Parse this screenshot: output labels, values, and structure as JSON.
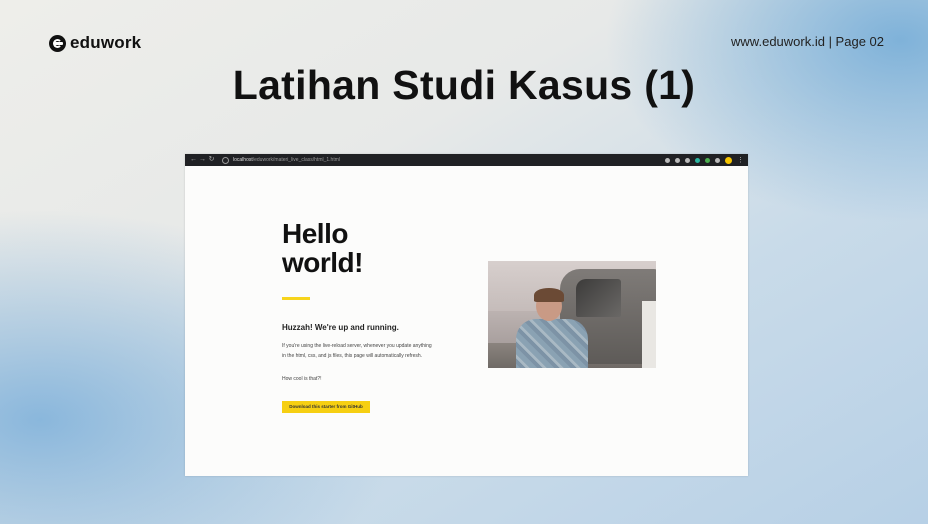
{
  "slide": {
    "logo_text": "eduwork",
    "page_ref": "www.eduwork.id | Page 02",
    "title": "Latihan Studi Kasus (1)"
  },
  "browser": {
    "url_host": "localhost",
    "url_path": "/eduwork/materi_live_class/html_1.html",
    "icons": [
      "back-icon",
      "forward-icon",
      "reload-icon",
      "search-icon",
      "star-icon",
      "extension-icon",
      "menu-icon"
    ]
  },
  "page": {
    "heading": "Hello world!",
    "heading_line1": "Hello",
    "heading_line2": "world!",
    "subheading": "Huzzah! We're up and running.",
    "paragraph": "If you're using the live-reload server, whenever you update anything in the html, css, and js files, this page will automatically refresh.",
    "question": "How cool is that?!",
    "button_label": "Download this starter from GitHub",
    "accent_color": "#f7d41c"
  }
}
